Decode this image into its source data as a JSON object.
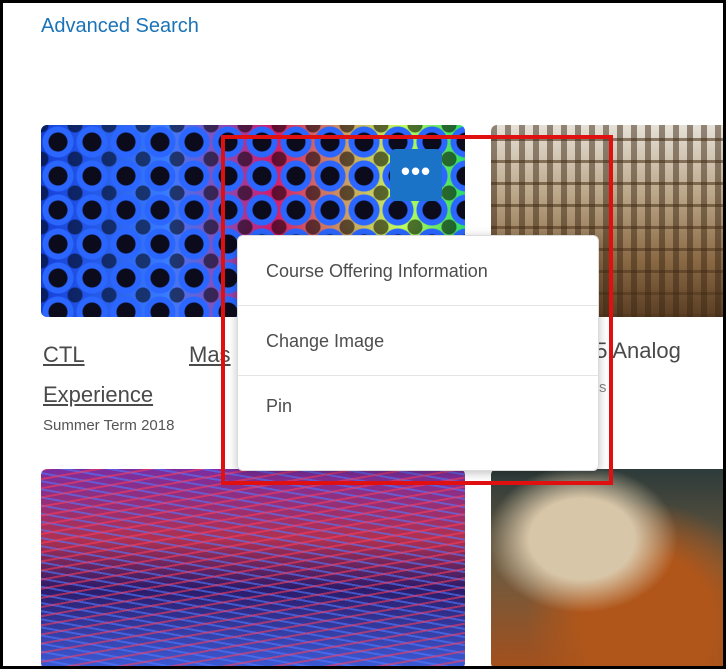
{
  "header": {
    "advanced_search": "Advanced Search"
  },
  "cards": [
    {
      "title_line1_a": "CTL",
      "title_line1_b": "Mas",
      "title_line2": "Experience",
      "term": "Summer Term 2018"
    },
    {
      "title_fragment": "15 Analog",
      "subtitle_fragment": "s"
    }
  ],
  "more_button": {
    "label": "•••",
    "icon": "ellipsis-icon",
    "color": "#1a73c6"
  },
  "menu": {
    "items": [
      {
        "label": "Course Offering Information"
      },
      {
        "label": "Change Image"
      },
      {
        "label": "Pin"
      }
    ]
  },
  "colors": {
    "link": "#1a73b8",
    "highlight": "#e01010"
  }
}
